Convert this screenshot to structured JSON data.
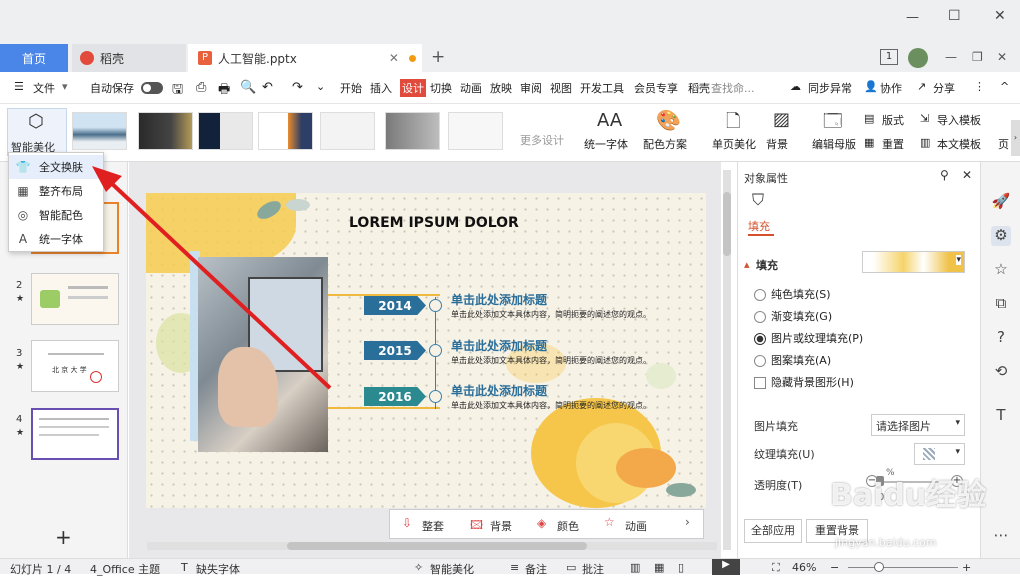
{
  "window": {
    "controls": {
      "minimize": "—",
      "maximize": "☐",
      "close": "✕"
    }
  },
  "tabs": [
    {
      "label": "首页"
    },
    {
      "label": "稻壳"
    },
    {
      "label": "人工智能.pptx"
    }
  ],
  "tab_add": "+",
  "tab_right": {
    "page_badge": "1"
  },
  "menu": {
    "file": "文件",
    "autosave": "自动保存",
    "items": [
      "开始",
      "插入",
      "设计",
      "切换",
      "动画",
      "放映",
      "审阅",
      "视图",
      "开发工具",
      "会员专享",
      "稻壳"
    ],
    "active": "设计",
    "search": "查找命...",
    "sync": "同步异常",
    "collab": "协作",
    "share": "分享",
    "more": "⋮",
    "collapse": "^"
  },
  "ribbon": {
    "smart_beautify": "智能美化",
    "more_design": "更多设计",
    "unify_font": "统一字体",
    "color_scheme": "配色方案",
    "single_beautify": "单页美化",
    "background": "背景",
    "edit_master": "编辑母版",
    "layout": "版式",
    "reset": "重置",
    "import_template": "导入模板",
    "this_template": "本文模板",
    "page": "页"
  },
  "dropdown": [
    {
      "icon": "shirt-icon",
      "glyph": "👕",
      "label": "全文换肤"
    },
    {
      "icon": "layout-icon",
      "glyph": "▦",
      "label": "整齐布局"
    },
    {
      "icon": "palette-icon",
      "glyph": "◎",
      "label": "智能配色"
    },
    {
      "icon": "font-icon",
      "glyph": "A",
      "label": "统一字体"
    }
  ],
  "slides": [
    {
      "num": "1"
    },
    {
      "num": "2"
    },
    {
      "num": "3"
    },
    {
      "num": "4"
    }
  ],
  "slide3_text": "北 京 大 学",
  "add_slide": "+",
  "slide": {
    "title": "LOREM IPSUM DOLOR",
    "timeline": [
      {
        "year": "2014",
        "heading": "单击此处添加标题",
        "desc": "单击此处添加文本具体内容，简明扼要的阐述您的观点。"
      },
      {
        "year": "2015",
        "heading": "单击此处添加标题",
        "desc": "单击此处添加文本具体内容，简明扼要的阐述您的观点。"
      },
      {
        "year": "2016",
        "heading": "单击此处添加标题",
        "desc": "单击此处添加文本具体内容，简明扼要的阐述您的观点。"
      }
    ]
  },
  "canvas_toolbar": [
    {
      "label": "整套"
    },
    {
      "label": "背景"
    },
    {
      "label": "颜色"
    },
    {
      "label": "动画"
    }
  ],
  "props": {
    "title": "对象属性",
    "tab": "填充",
    "section": "填充",
    "options": [
      {
        "label": "纯色填充(S)",
        "checked": false
      },
      {
        "label": "渐变填充(G)",
        "checked": false
      },
      {
        "label": "图片或纹理填充(P)",
        "checked": true
      },
      {
        "label": "图案填充(A)",
        "checked": false
      }
    ],
    "hide_bg": "隐藏背景图形(H)",
    "pic_fill_label": "图片填充",
    "pic_fill_value": "请选择图片",
    "texture_label": "纹理填充(U)",
    "transparency_label": "透明度(T)",
    "transparency_value": "0",
    "apply_all": "全部应用",
    "reset_bg": "重置背景"
  },
  "status": {
    "slide": "幻灯片 1 / 4",
    "theme": "4_Office 主题",
    "missing_font": "缺失字体",
    "beautify": "智能美化",
    "notes": "备注",
    "comments": "批注",
    "zoom": "46%"
  },
  "watermark": "Baidu经验",
  "watermark_url": "jingyan.baidu.com"
}
